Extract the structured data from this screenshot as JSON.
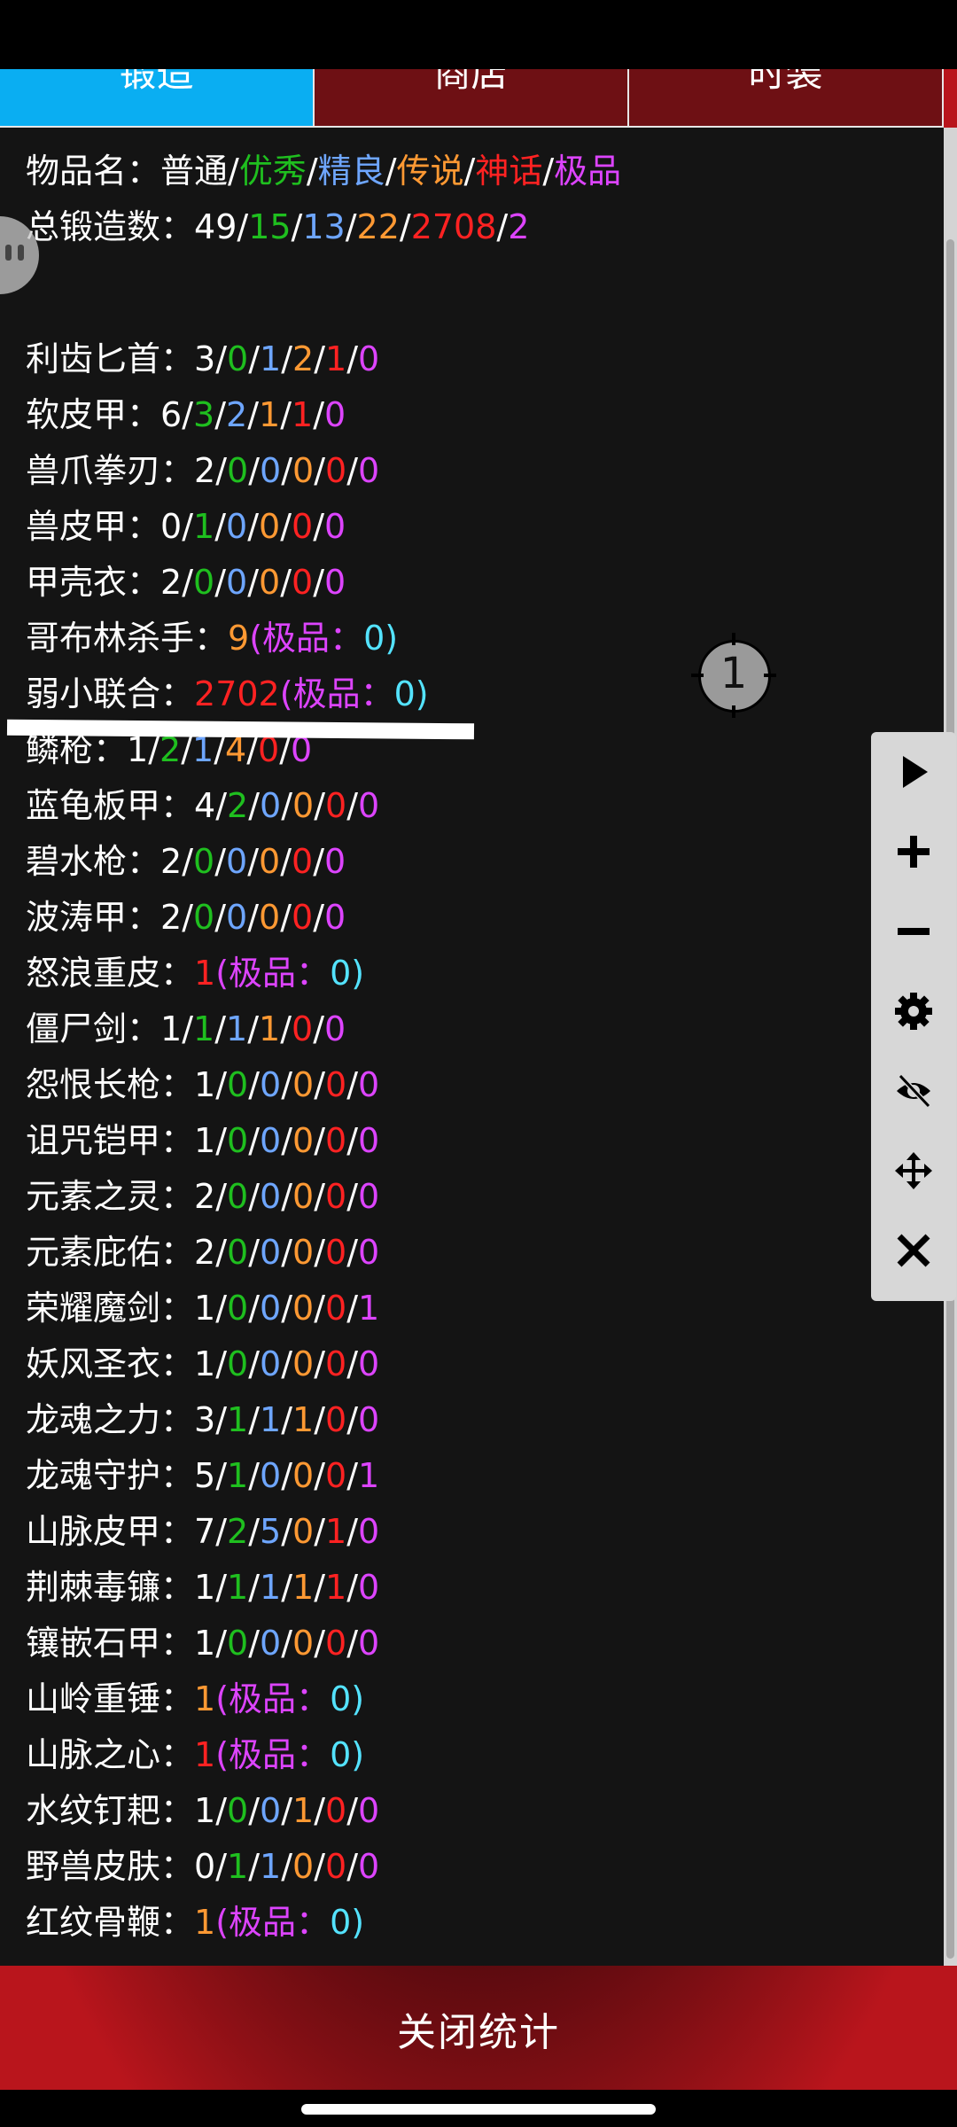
{
  "tabs": [
    {
      "label": "锻造",
      "active": true
    },
    {
      "label": "商店",
      "active": false
    },
    {
      "label": "时装",
      "active": false
    }
  ],
  "summary": {
    "item_name_label": "物品名：",
    "grades": [
      "普通",
      "优秀",
      "精良",
      "传说",
      "神话",
      "极品"
    ],
    "total_label": "总锻造数：",
    "total_values": [
      "49",
      "15",
      "13",
      "22",
      "2708",
      "2"
    ]
  },
  "items": [
    {
      "name": "利齿匕首",
      "values": [
        "3",
        "0",
        "1",
        "2",
        "1",
        "0"
      ]
    },
    {
      "name": "软皮甲",
      "values": [
        "6",
        "3",
        "2",
        "1",
        "1",
        "0"
      ]
    },
    {
      "name": "兽爪拳刃",
      "values": [
        "2",
        "0",
        "0",
        "0",
        "0",
        "0"
      ]
    },
    {
      "name": "兽皮甲",
      "values": [
        "0",
        "1",
        "0",
        "0",
        "0",
        "0"
      ]
    },
    {
      "name": "甲壳衣",
      "values": [
        "2",
        "0",
        "0",
        "0",
        "0",
        "0"
      ]
    },
    {
      "name": "哥布林杀手",
      "count": "9",
      "count_grade": "legend",
      "extreme_label": "极品：",
      "extreme": "0"
    },
    {
      "name": "弱小联合",
      "count": "2702",
      "count_grade": "myth",
      "extreme_label": "极品：",
      "extreme": "0"
    },
    {
      "name": "鳞枪",
      "values": [
        "1",
        "2",
        "1",
        "4",
        "0",
        "0"
      ]
    },
    {
      "name": "蓝龟板甲",
      "values": [
        "4",
        "2",
        "0",
        "0",
        "0",
        "0"
      ]
    },
    {
      "name": "碧水枪",
      "values": [
        "2",
        "0",
        "0",
        "0",
        "0",
        "0"
      ]
    },
    {
      "name": "波涛甲",
      "values": [
        "2",
        "0",
        "0",
        "0",
        "0",
        "0"
      ]
    },
    {
      "name": "怒浪重皮",
      "count": "1",
      "count_grade": "myth",
      "extreme_label": "极品：",
      "extreme": "0"
    },
    {
      "name": "僵尸剑",
      "values": [
        "1",
        "1",
        "1",
        "1",
        "0",
        "0"
      ]
    },
    {
      "name": "怨恨长枪",
      "values": [
        "1",
        "0",
        "0",
        "0",
        "0",
        "0"
      ]
    },
    {
      "name": "诅咒铠甲",
      "values": [
        "1",
        "0",
        "0",
        "0",
        "0",
        "0"
      ]
    },
    {
      "name": "元素之灵",
      "values": [
        "2",
        "0",
        "0",
        "0",
        "0",
        "0"
      ]
    },
    {
      "name": "元素庇佑",
      "values": [
        "2",
        "0",
        "0",
        "0",
        "0",
        "0"
      ]
    },
    {
      "name": "荣耀魔剑",
      "values": [
        "1",
        "0",
        "0",
        "0",
        "0",
        "1"
      ]
    },
    {
      "name": "妖风圣衣",
      "values": [
        "1",
        "0",
        "0",
        "0",
        "0",
        "0"
      ]
    },
    {
      "name": "龙魂之力",
      "values": [
        "3",
        "1",
        "1",
        "1",
        "0",
        "0"
      ]
    },
    {
      "name": "龙魂守护",
      "values": [
        "5",
        "1",
        "0",
        "0",
        "0",
        "1"
      ]
    },
    {
      "name": "山脉皮甲",
      "values": [
        "7",
        "2",
        "5",
        "0",
        "1",
        "0"
      ]
    },
    {
      "name": "荆棘毒镰",
      "values": [
        "1",
        "1",
        "1",
        "1",
        "1",
        "0"
      ]
    },
    {
      "name": "镶嵌石甲",
      "values": [
        "1",
        "0",
        "0",
        "0",
        "0",
        "0"
      ]
    },
    {
      "name": "山岭重锤",
      "count": "1",
      "count_grade": "legend",
      "extreme_label": "极品：",
      "extreme": "0"
    },
    {
      "name": "山脉之心",
      "count": "1",
      "count_grade": "myth",
      "extreme_label": "极品：",
      "extreme": "0"
    },
    {
      "name": "水纹钉耙",
      "values": [
        "1",
        "0",
        "0",
        "1",
        "0",
        "0"
      ]
    },
    {
      "name": "野兽皮肤",
      "values": [
        "0",
        "1",
        "1",
        "0",
        "0",
        "0"
      ]
    },
    {
      "name": "红纹骨鞭",
      "count": "1",
      "count_grade": "legend",
      "extreme_label": "极品：",
      "extreme": "0"
    }
  ],
  "target_marker": "1",
  "toolbar": [
    "play-icon",
    "plus-icon",
    "minus-icon",
    "gear-icon",
    "eye-off-icon",
    "move-icon",
    "close-icon"
  ],
  "close_button": "关闭统计",
  "colors": {
    "normal": "#ffffff",
    "good": "#1fbf1f",
    "fine": "#6ea6ff",
    "legend": "#ff9933",
    "myth": "#ff2222",
    "extreme": "#dd44ff",
    "tab_active": "#0aaef2",
    "extreme_count": "#54e3ff"
  }
}
